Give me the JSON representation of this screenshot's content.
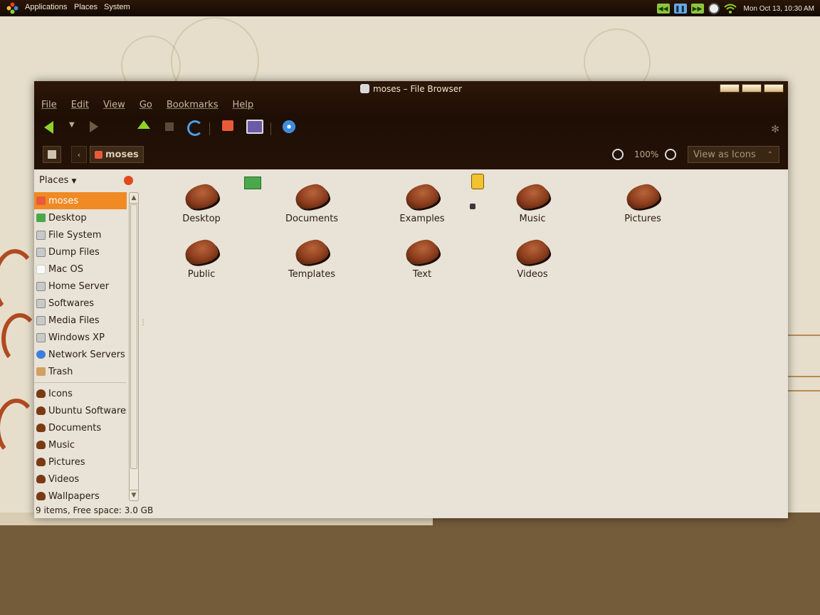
{
  "top_panel": {
    "menus": [
      "Applications",
      "Places",
      "System"
    ],
    "clock": "Mon Oct 13, 10:30 AM"
  },
  "window": {
    "title": "moses – File Browser",
    "menubar": [
      "File",
      "Edit",
      "View",
      "Go",
      "Bookmarks",
      "Help"
    ],
    "location": {
      "crumb": "moses",
      "zoom": "100%",
      "view_mode": "View as Icons"
    },
    "sidebar": {
      "header": "Places",
      "items": [
        {
          "label": "moses",
          "icon": "home-icon"
        },
        {
          "label": "Desktop",
          "icon": "desktop-icon"
        },
        {
          "label": "File System",
          "icon": "drive-icon"
        },
        {
          "label": "Dump Files",
          "icon": "drive-icon"
        },
        {
          "label": "Mac OS",
          "icon": "drive-icon"
        },
        {
          "label": "Home Server",
          "icon": "drive-icon"
        },
        {
          "label": "Softwares",
          "icon": "drive-icon"
        },
        {
          "label": "Media Files",
          "icon": "drive-icon"
        },
        {
          "label": "Windows XP",
          "icon": "drive-icon"
        },
        {
          "label": "Network Servers",
          "icon": "network-icon"
        },
        {
          "label": "Trash",
          "icon": "trash-icon"
        }
      ],
      "bookmarks": [
        {
          "label": "Icons"
        },
        {
          "label": "Ubuntu Softwares"
        },
        {
          "label": "Documents"
        },
        {
          "label": "Music"
        },
        {
          "label": "Pictures"
        },
        {
          "label": "Videos"
        },
        {
          "label": "Wallpapers"
        }
      ]
    },
    "files": [
      "Desktop",
      "Documents",
      "Examples",
      "Music",
      "Pictures",
      "Public",
      "Templates",
      "Text",
      "Videos"
    ],
    "status": "9 items, Free space: 3.0 GB"
  },
  "colors": {
    "accent": "#f08a24",
    "chrome": "#1e0e04"
  }
}
